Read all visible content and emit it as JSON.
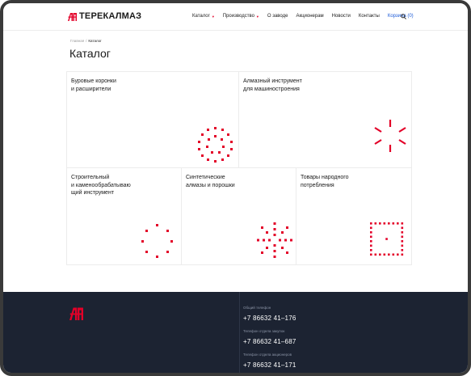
{
  "brand": {
    "name": "ТЕРЕКАЛМАЗ",
    "accent_color": "#e30028",
    "link_color": "#1d5bd8",
    "footer_bg": "#1c2332"
  },
  "nav": {
    "items": [
      {
        "label": "Каталог",
        "has_dropdown": true
      },
      {
        "label": "Производство",
        "has_dropdown": true
      },
      {
        "label": "О заводе",
        "has_dropdown": false
      },
      {
        "label": "Акционерам",
        "has_dropdown": false
      },
      {
        "label": "Новости",
        "has_dropdown": false
      },
      {
        "label": "Контакты",
        "has_dropdown": false
      }
    ],
    "cart_label": "Корзина (0)",
    "search_icon": "search-icon"
  },
  "breadcrumb": {
    "home": "Главная",
    "separator": "/",
    "current": "Каталог"
  },
  "page": {
    "title": "Каталог"
  },
  "catalog": {
    "cards": [
      {
        "title": "Буровые коронки\nи расширители",
        "icon": "dotted-ring-icon"
      },
      {
        "title": "Алмазный инструмент\nдля машиностроения",
        "icon": "burst-icon"
      },
      {
        "title": "Строительный\nи каменообрабатываю\nщий инструмент",
        "icon": "dotted-circle-icon"
      },
      {
        "title": "Синтетические\nалмазы и порошки",
        "icon": "snowflake-icon"
      },
      {
        "title": "Товары народного\nпотребления",
        "icon": "dotted-square-icon"
      }
    ]
  },
  "footer": {
    "contacts": [
      {
        "label": "Общий телефон",
        "phone": "+7 86632 41–176"
      },
      {
        "label": "Телефон отдела закупок",
        "phone": "+7 86632 41–687"
      },
      {
        "label": "Телефон отдела акционеров",
        "phone": "+7 86632 41–171"
      }
    ]
  }
}
